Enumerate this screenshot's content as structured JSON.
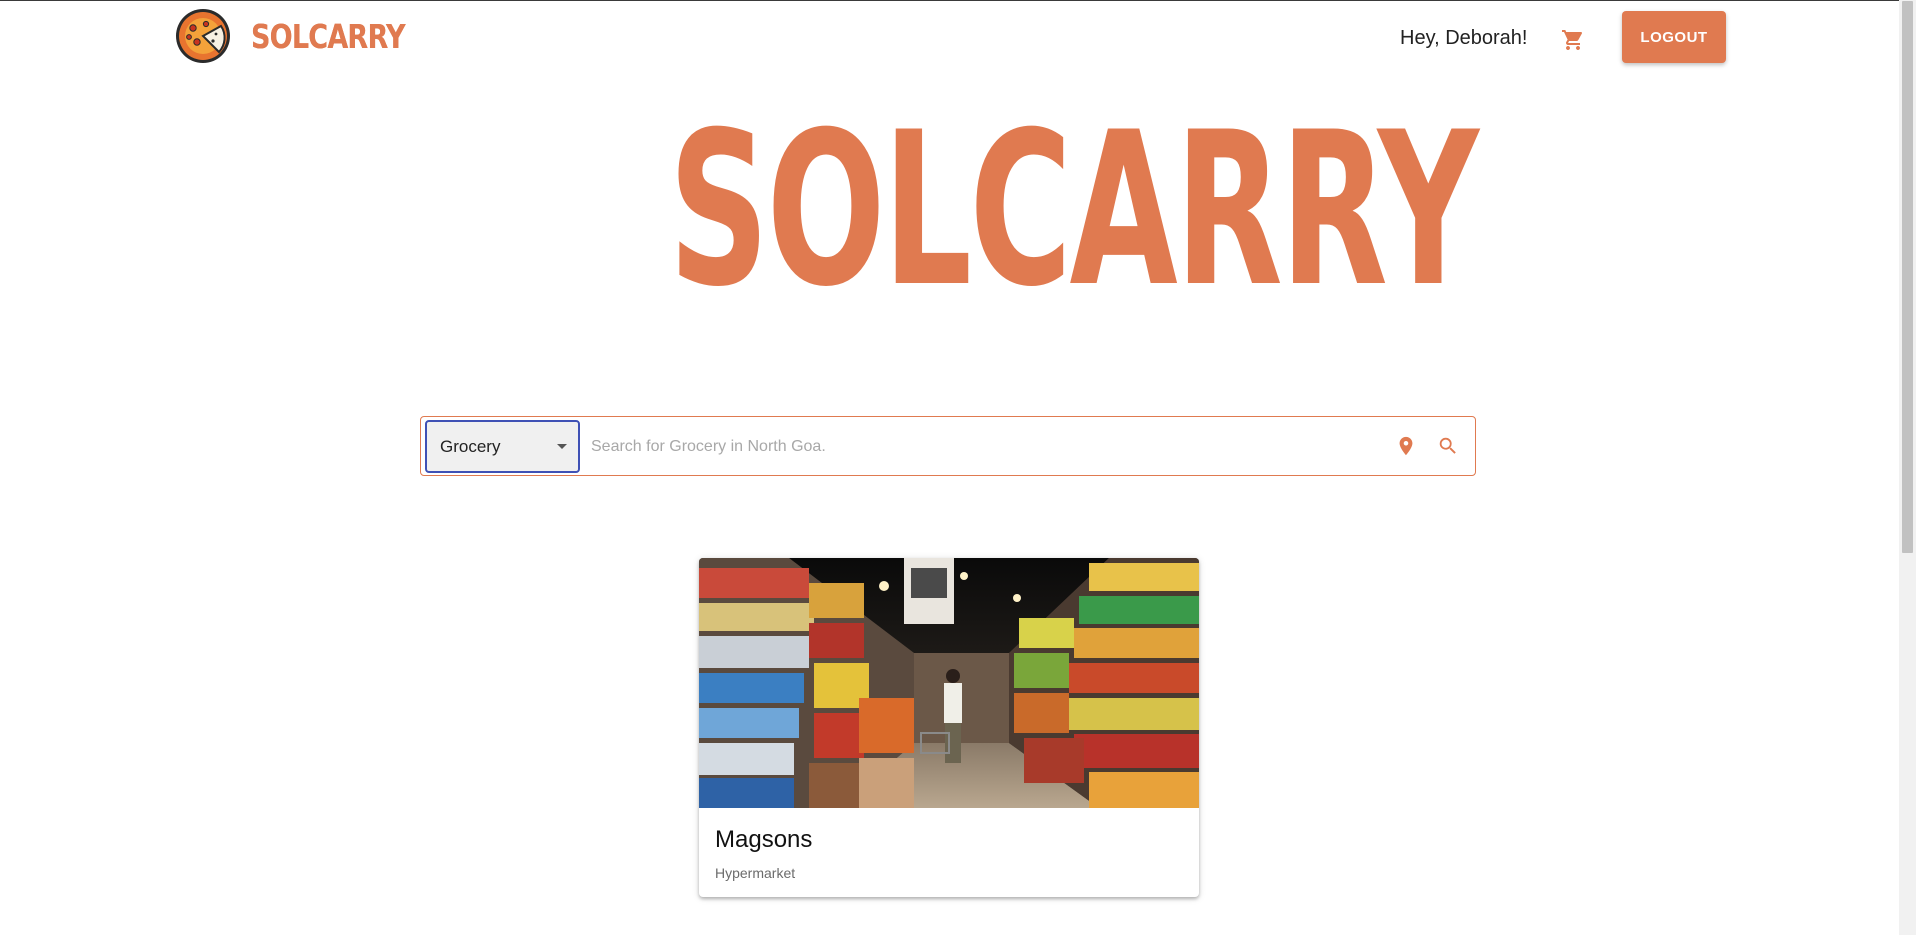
{
  "header": {
    "brand": "SOLCARRY",
    "greeting": "Hey,  Deborah!",
    "logout_label": "LOGOUT"
  },
  "hero": {
    "title": "SOLCARRY"
  },
  "search": {
    "category": "Grocery",
    "placeholder": "Search for Grocery in North Goa."
  },
  "results": [
    {
      "name": "Magsons",
      "type": "Hypermarket"
    }
  ],
  "colors": {
    "accent": "#e07a50",
    "select_border": "#3f51b5"
  },
  "icons": {
    "cart": "shopping-cart-icon",
    "location": "location-pin-icon",
    "search": "search-icon"
  }
}
